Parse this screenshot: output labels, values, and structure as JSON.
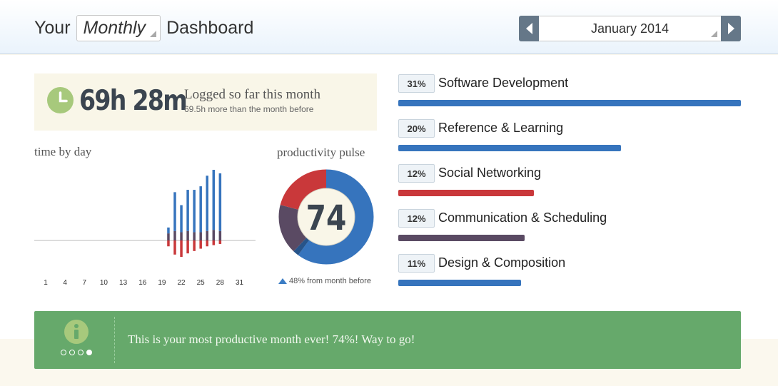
{
  "header": {
    "title_prefix": "Your",
    "period": "Monthly",
    "title_suffix": "Dashboard",
    "month": "January 2014"
  },
  "logged": {
    "hours": "69h 28m",
    "label": "Logged so far this month",
    "sub": "69.5h more than the month before"
  },
  "time_by_day": {
    "label": "time by day"
  },
  "pulse": {
    "label": "productivity pulse",
    "score": "74",
    "sub": "48% from month before"
  },
  "categories": [
    {
      "pct": "31%",
      "name": "Software Development",
      "fill": 1.0,
      "color": "#3674bd"
    },
    {
      "pct": "20%",
      "name": "Reference & Learning",
      "fill": 0.65,
      "color": "#3674bd"
    },
    {
      "pct": "12%",
      "name": "Social Networking",
      "fill": 0.395,
      "color": "#c9383a"
    },
    {
      "pct": "12%",
      "name": "Communication & Scheduling",
      "fill": 0.368,
      "color": "#5a4a63"
    },
    {
      "pct": "11%",
      "name": "Design & Composition",
      "fill": 0.358,
      "color": "#3674bd"
    }
  ],
  "tip": {
    "message": "This is your most productive month ever! 74%! Way to go!",
    "dots": [
      false,
      false,
      false,
      true
    ]
  },
  "colors": {
    "productive": "#3674bd",
    "neutral": "#5a4a63",
    "distracting": "#c9383a",
    "tip_bg": "#66a96b"
  },
  "chart_data": [
    {
      "type": "bar",
      "title": "time by day",
      "x_tick_labels": [
        "1",
        "4",
        "7",
        "10",
        "13",
        "16",
        "19",
        "22",
        "25",
        "28",
        "31"
      ],
      "days": [
        20,
        21,
        22,
        23,
        24,
        25,
        26,
        27,
        28
      ],
      "series": [
        {
          "values": [
            0.5,
            3.3,
            2.3,
            3.5,
            3.6,
            3.9,
            4.7,
            5.1,
            4.9
          ]
        },
        {
          "values": [
            0.6,
            0.8,
            0.7,
            0.8,
            0.7,
            0.7,
            0.8,
            0.9,
            0.8
          ]
        },
        {
          "values": [
            -0.5,
            -1.2,
            -1.4,
            -1.1,
            -0.9,
            -0.7,
            -0.5,
            -0.4,
            -0.3
          ]
        }
      ]
    },
    {
      "type": "pie",
      "title": "productivity pulse",
      "center_label": "74",
      "slices": [
        {
          "value": 0.6,
          "color": "#3674bd"
        },
        {
          "value": 0.02,
          "color": "#27548a"
        },
        {
          "value": 0.17,
          "color": "#5a4a63"
        },
        {
          "value": 0.21,
          "color": "#c9383a"
        }
      ]
    }
  ]
}
